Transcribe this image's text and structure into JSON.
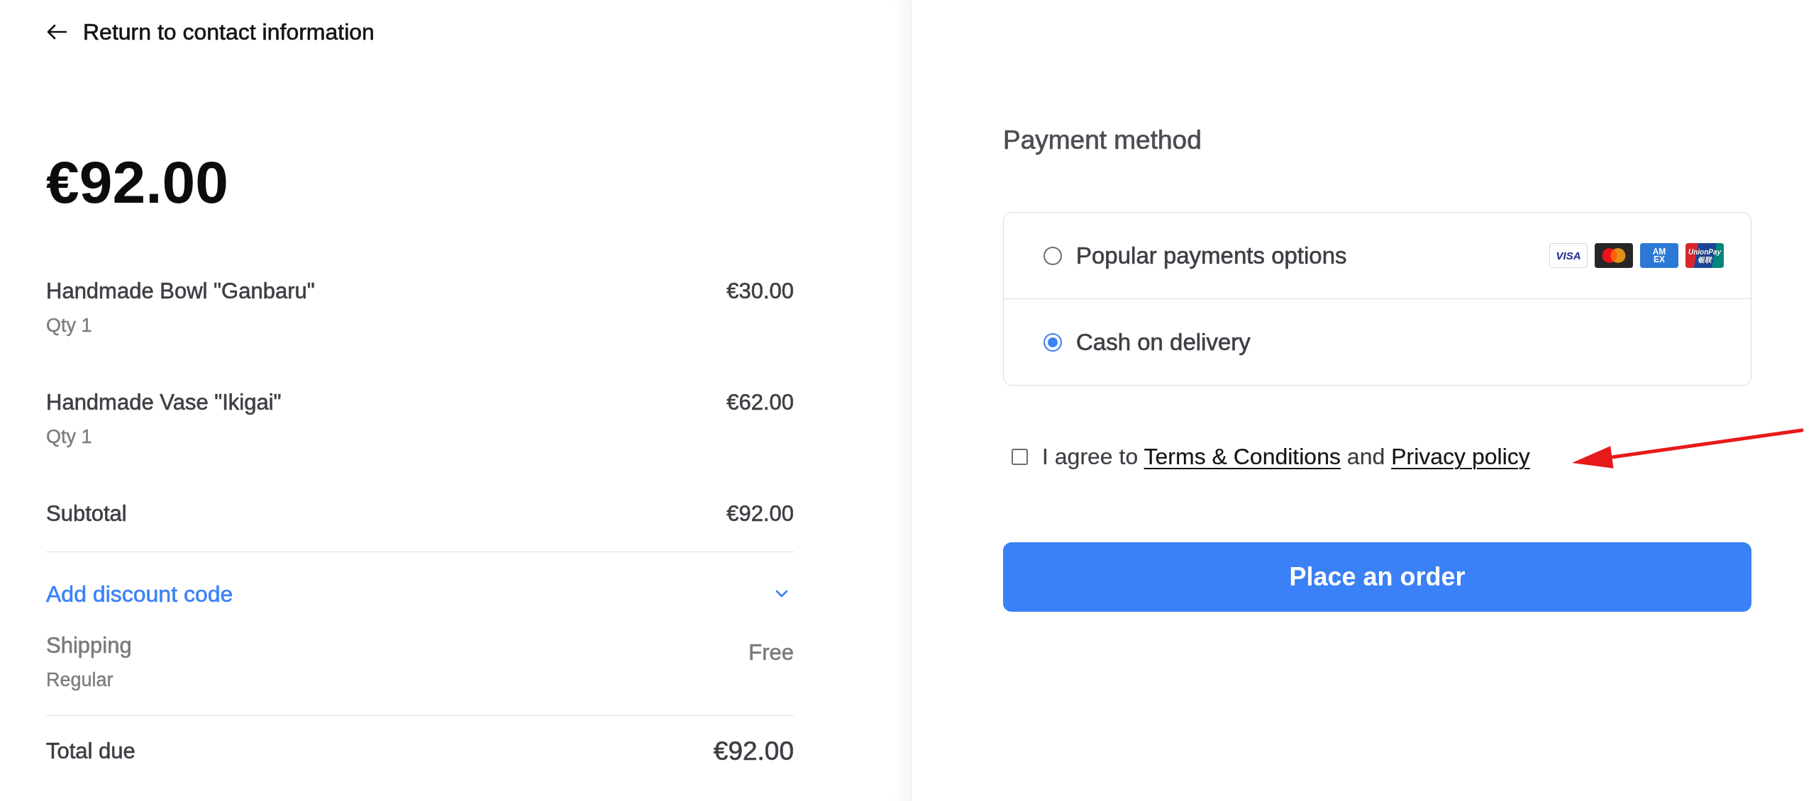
{
  "back_link": {
    "label": "Return to contact information"
  },
  "order_total_heading": "€92.00",
  "items": [
    {
      "name": "Handmade Bowl \"Ganbaru\"",
      "quantity": "Qty 1",
      "price": "€30.00"
    },
    {
      "name": "Handmade Vase \"Ikigai\"",
      "quantity": "Qty 1",
      "price": "€62.00"
    }
  ],
  "subtotal": {
    "label": "Subtotal",
    "value": "€92.00"
  },
  "discount": {
    "label": "Add discount code",
    "expanded": false
  },
  "shipping": {
    "label": "Shipping",
    "method": "Regular",
    "value": "Free"
  },
  "total": {
    "label": "Total due",
    "value": "€92.00"
  },
  "payment": {
    "title": "Payment method",
    "options": [
      {
        "label": "Popular payments options",
        "selected": false,
        "card_logos": [
          {
            "kind": "visa",
            "label": "VISA"
          },
          {
            "kind": "mastercard"
          },
          {
            "kind": "amex",
            "label": "AM EX"
          },
          {
            "kind": "unionpay",
            "label": "UnionPay 银联"
          }
        ]
      },
      {
        "label": "Cash on delivery",
        "selected": true
      }
    ]
  },
  "consent": {
    "checked": false,
    "prefix": "I agree to",
    "terms_link": "Terms & Conditions",
    "joiner": "and",
    "privacy_link": "Privacy policy"
  },
  "place_order_button": {
    "label": "Place an order"
  }
}
